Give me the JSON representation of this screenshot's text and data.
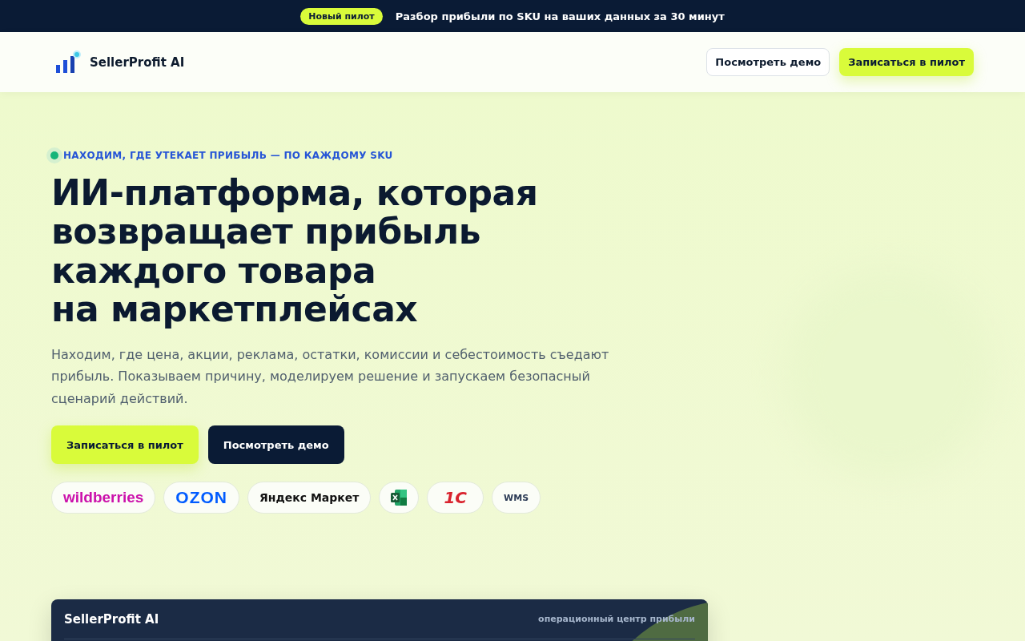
{
  "announcement": {
    "badge": "Новый пилот",
    "text": "Разбор прибыли по SKU на ваших данных за 30 минут"
  },
  "header": {
    "brand": "SellerProfit AI",
    "buttons": [
      {
        "label": "Посмотреть демо",
        "kind": "secondary"
      },
      {
        "label": "Записаться в пилот",
        "kind": "primary"
      }
    ]
  },
  "hero": {
    "eyebrow": "НАХОДИМ, ГДЕ УТЕКАЕТ ПРИБЫЛЬ — ПО КАЖДОМУ SKU",
    "title_lines": [
      "ИИ-платформа, которая",
      "возвращает прибыль",
      "каждого товара",
      "на маркетплейсах"
    ],
    "subtitle": "Находим, где цена, акции, реклама, остатки, комиссии и себестоимость съедают прибыль. Показываем причину, моделируем решение и запускаем безопасный сценарий действий.",
    "buttons": [
      {
        "label": "Записаться в пилот",
        "kind": "primary"
      },
      {
        "label": "Посмотреть демо",
        "kind": "dark"
      }
    ],
    "integrations": [
      {
        "kind": "text",
        "label": "wildberries",
        "color": "#cb11ab"
      },
      {
        "kind": "text",
        "label": "OZON",
        "color": "#005bff"
      },
      {
        "kind": "text",
        "label": "Яндекс Маркет",
        "color": "#111111"
      },
      {
        "kind": "excel"
      },
      {
        "kind": "text",
        "label": "1С",
        "color": "#d9232e"
      },
      {
        "kind": "text",
        "label": "WMS",
        "color": "#2b3a55"
      }
    ]
  },
  "panel": {
    "title": "SellerProfit AI",
    "subtitle": "операционный центр прибыли"
  }
}
